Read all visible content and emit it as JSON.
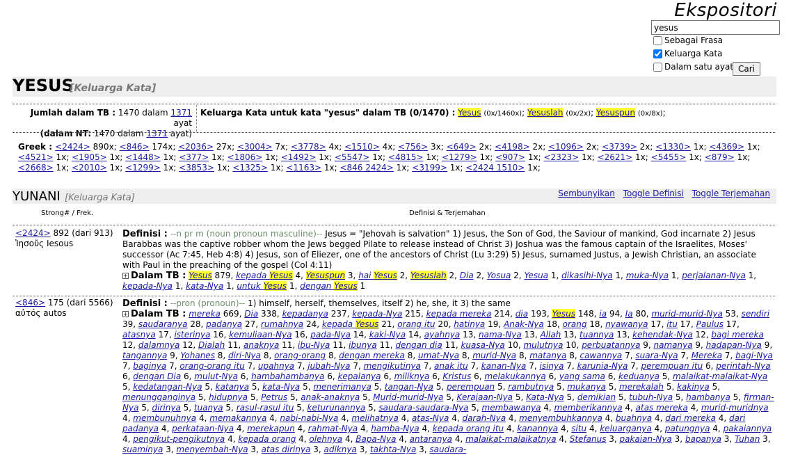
{
  "brand": "Ekspositori",
  "search": {
    "value": "yesus"
  },
  "options": [
    {
      "label": "Sebagai Frasa",
      "checked": false
    },
    {
      "label": "Keluarga Kata",
      "checked": true
    },
    {
      "label": "Dalam satu ayat",
      "checked": false
    }
  ],
  "cari_label": "Cari",
  "title": "YESUS",
  "title_tag": "[Keluarga Kata]",
  "stats": {
    "line1_prefix": "Jumlah dalam TB :",
    "line1_count": "1470",
    "line1_mid": "dalam",
    "line1_link": "1371",
    "line1_suffix": "ayat",
    "line2_prefix": "(dalam NT:",
    "line2_count": "1470",
    "line2_mid": "dalam",
    "line2_link": "1371",
    "line2_suffix": "ayat)"
  },
  "family": {
    "label": "Keluarga Kata untuk kata \"yesus\" dalam TB (0/1470) :",
    "items": [
      {
        "word": "Yesus",
        "count": "(0x/1460x)"
      },
      {
        "word": "Yesuslah",
        "count": "(0x/2x)"
      },
      {
        "word": "Yesuspun",
        "count": "(0x/8x)"
      }
    ]
  },
  "greek": {
    "label": "Greek :",
    "items": [
      [
        "<2424>",
        "890x"
      ],
      [
        "<846>",
        "174x"
      ],
      [
        "<2036>",
        "27x"
      ],
      [
        "<3004>",
        "7x"
      ],
      [
        "<3778>",
        "4x"
      ],
      [
        "<1510>",
        "4x"
      ],
      [
        "<756>",
        "3x"
      ],
      [
        "<649>",
        "2x"
      ],
      [
        "<4198>",
        "2x"
      ],
      [
        "<1096>",
        "2x"
      ],
      [
        "<3739>",
        "2x"
      ],
      [
        "<1330>",
        "1x"
      ],
      [
        "<4369>",
        "1x"
      ],
      [
        "<4521>",
        "1x"
      ],
      [
        "<1905>",
        "1x"
      ],
      [
        "<1448>",
        "1x"
      ],
      [
        "<377>",
        "1x"
      ],
      [
        "<1806>",
        "1x"
      ],
      [
        "<1492>",
        "1x"
      ],
      [
        "<5547>",
        "1x"
      ],
      [
        "<4815>",
        "1x"
      ],
      [
        "<1279>",
        "1x"
      ],
      [
        "<907>",
        "1x"
      ],
      [
        "<2323>",
        "1x"
      ],
      [
        "<2621>",
        "1x"
      ],
      [
        "<5455>",
        "1x"
      ],
      [
        "<879>",
        "1x"
      ],
      [
        "<2668>",
        "1x"
      ],
      [
        "<2010>",
        "1x"
      ],
      [
        "<1299>",
        "1x"
      ],
      [
        "<3853>",
        "1x"
      ],
      [
        "<1325>",
        "1x"
      ],
      [
        "<1163>",
        "1x"
      ],
      [
        "<846 2424>",
        "1x"
      ],
      [
        "<3199>",
        "1x"
      ],
      [
        "<2424 1510>",
        "1x"
      ]
    ]
  },
  "yunani": {
    "title": "YUNANI",
    "tag": "[Keluarga Kata]"
  },
  "section_links": [
    "Sembunyikan",
    "Toggle Definisi",
    "Toggle Terjemahan"
  ],
  "table_headers": {
    "left": "Strong# / Frek.",
    "right": "Definisi & Terjemahan"
  },
  "entries": [
    {
      "strong": "<2424>",
      "freq": "892 (dari 913)",
      "greek": "Ἰησοῦς",
      "translit": "Iesous",
      "def_label": "Definisi :",
      "pos": "--n pr m (noun pronoun masculine)--",
      "definition": "Jesus = \"Jehovah is salvation\" 1) Jesus, the Son of God, the Saviour of mankind, God incarnate 2) Jesus Barabbas was the captive robber whom the Jews begged Pilate to release instead of Christ 3) Joshua was the famous captain of the Israelites, Moses' successor (Ac 7:45, Heb 4:8) 4) Jesus, son of Eliezer, one of the ancestors of Christ (Lu 3:29) 5) Jesus, surnamed Justus, a Jewish Christian, an associate with Paul in the preaching of the gospel (Col 4:11)",
      "tb_label": "Dalam TB :",
      "words": [
        [
          "Yesus",
          "879"
        ],
        [
          "kepada Yesus",
          "4"
        ],
        [
          "Yesuspun",
          "3"
        ],
        [
          "hai Yesus",
          "2"
        ],
        [
          "Yesuslah",
          "2"
        ],
        [
          "Dia",
          "2"
        ],
        [
          "Yosua",
          "2"
        ],
        [
          "Yesua",
          "1"
        ],
        [
          "dikasihi-Nya",
          "1"
        ],
        [
          "muka-Nya",
          "1"
        ],
        [
          "perjalanan-Nya",
          "1"
        ],
        [
          "kepada-Nya",
          "1"
        ],
        [
          "kata-Nya",
          "1"
        ],
        [
          "untuk Yesus",
          "1"
        ],
        [
          "dengan Yesus",
          "1"
        ]
      ]
    },
    {
      "strong": "<846>",
      "freq": "175 (dari 5566)",
      "greek": "αὐτός",
      "translit": "autos",
      "def_label": "Definisi :",
      "pos": "--pron (pronoun)--",
      "definition": "1) himself, herself, themselves, itself 2) he, she, it 3) the same",
      "tb_label": "Dalam TB :",
      "words": [
        [
          "mereka",
          "669"
        ],
        [
          "Dia",
          "338"
        ],
        [
          "kepadanya",
          "237"
        ],
        [
          "kepada-Nya",
          "215"
        ],
        [
          "kepada mereka",
          "214"
        ],
        [
          "dia",
          "193"
        ],
        [
          "Yesus",
          "148"
        ],
        [
          "ia",
          "94"
        ],
        [
          "Ia",
          "80"
        ],
        [
          "murid-murid-Nya",
          "53"
        ],
        [
          "sendiri",
          "39"
        ],
        [
          "saudaranya",
          "28"
        ],
        [
          "padanya",
          "27"
        ],
        [
          "rumahnya",
          "24"
        ],
        [
          "kepada Yesus",
          "21"
        ],
        [
          "orang itu",
          "20"
        ],
        [
          "hatinya",
          "19"
        ],
        [
          "Anak-Nya",
          "18"
        ],
        [
          "orang",
          "18"
        ],
        [
          "nyawanya",
          "17"
        ],
        [
          "itu",
          "17"
        ],
        [
          "Paulus",
          "17"
        ],
        [
          "atasnya",
          "17"
        ],
        [
          "isterinya",
          "16"
        ],
        [
          "kemuliaan-Nya",
          "16"
        ],
        [
          "pada-Nya",
          "14"
        ],
        [
          "kaki-Nya",
          "14"
        ],
        [
          "ayahnya",
          "13"
        ],
        [
          "nama-Nya",
          "13"
        ],
        [
          "Allah",
          "13"
        ],
        [
          "tuannya",
          "13"
        ],
        [
          "kehendak-Nya",
          "12"
        ],
        [
          "bagi mereka",
          "12"
        ],
        [
          "dalamnya",
          "12"
        ],
        [
          "Dialah",
          "11"
        ],
        [
          "anaknya",
          "11"
        ],
        [
          "ibu-Nya",
          "11"
        ],
        [
          "ibunya",
          "11"
        ],
        [
          "dengan dia",
          "11"
        ],
        [
          "kuasa-Nya",
          "10"
        ],
        [
          "mulutnya",
          "10"
        ],
        [
          "perbuatannya",
          "9"
        ],
        [
          "namanya",
          "9"
        ],
        [
          "hadapan-Nya",
          "9"
        ],
        [
          "tangannya",
          "9"
        ],
        [
          "Yohanes",
          "8"
        ],
        [
          "diri-Nya",
          "8"
        ],
        [
          "orang-orang",
          "8"
        ],
        [
          "dengan mereka",
          "8"
        ],
        [
          "umat-Nya",
          "8"
        ],
        [
          "murid-Nya",
          "8"
        ],
        [
          "matanya",
          "8"
        ],
        [
          "cawannya",
          "7"
        ],
        [
          "suara-Nya",
          "7"
        ],
        [
          "Mereka",
          "7"
        ],
        [
          "bagi-Nya",
          "7"
        ],
        [
          "baginya",
          "7"
        ],
        [
          "orang-orang itu",
          "7"
        ],
        [
          "upahnya",
          "7"
        ],
        [
          "jubah-Nya",
          "7"
        ],
        [
          "mengikutinya",
          "7"
        ],
        [
          "anak itu",
          "7"
        ],
        [
          "kanan-Nya",
          "7"
        ],
        [
          "isinya",
          "7"
        ],
        [
          "karunia-Nya",
          "7"
        ],
        [
          "perempuan itu",
          "6"
        ],
        [
          "perintah-Nya",
          "6"
        ],
        [
          "dengan Dia",
          "6"
        ],
        [
          "mulut-Nya",
          "6"
        ],
        [
          "hambahambanya",
          "6"
        ],
        [
          "kepalanya",
          "6"
        ],
        [
          "miliknya",
          "6"
        ],
        [
          "Kristus",
          "6"
        ],
        [
          "melakukannya",
          "6"
        ],
        [
          "yang sama",
          "6"
        ],
        [
          "keduanya",
          "5"
        ],
        [
          "malaikat-malaikat-Nya",
          "5"
        ],
        [
          "kedatangan-Nya",
          "5"
        ],
        [
          "katanya",
          "5"
        ],
        [
          "kata-Nya",
          "5"
        ],
        [
          "menerimanya",
          "5"
        ],
        [
          "tangan-Nya",
          "5"
        ],
        [
          "perempuan",
          "5"
        ],
        [
          "rambutnya",
          "5"
        ],
        [
          "mukanya",
          "5"
        ],
        [
          "merekalah",
          "5"
        ],
        [
          "kakinya",
          "5"
        ],
        [
          "menungganginya",
          "5"
        ],
        [
          "hidupnya",
          "5"
        ],
        [
          "Petrus",
          "5"
        ],
        [
          "anak-anaknya",
          "5"
        ],
        [
          "Murid-murid-Nya",
          "5"
        ],
        [
          "Kerajaan-Nya",
          "5"
        ],
        [
          "Kata-Nya",
          "5"
        ],
        [
          "demikian",
          "5"
        ],
        [
          "tubuh-Nya",
          "5"
        ],
        [
          "hambanya",
          "5"
        ],
        [
          "firman-Nya",
          "5"
        ],
        [
          "dirinya",
          "5"
        ],
        [
          "tuanya",
          "5"
        ],
        [
          "rasul-rasul itu",
          "5"
        ],
        [
          "keturunannya",
          "5"
        ],
        [
          "saudara-saudara-Nya",
          "5"
        ],
        [
          "membawanya",
          "4"
        ],
        [
          "memberikannya",
          "4"
        ],
        [
          "atas mereka",
          "4"
        ],
        [
          "murid-muridnya",
          "4"
        ],
        [
          "membunuhnya",
          "4"
        ],
        [
          "memakannya",
          "4"
        ],
        [
          "nabi-nabi-Nya",
          "4"
        ],
        [
          "melihatnya",
          "4"
        ],
        [
          "atas-Nya",
          "4"
        ],
        [
          "darah-Nya",
          "4"
        ],
        [
          "menyembuhkannya",
          "4"
        ],
        [
          "buahnya",
          "4"
        ],
        [
          "dari mereka",
          "4"
        ],
        [
          "dari padanya",
          "4"
        ],
        [
          "perkataan-Nya",
          "4"
        ],
        [
          "merekapun",
          "4"
        ],
        [
          "rahmat-Nya",
          "4"
        ],
        [
          "hamba-Nya",
          "4"
        ],
        [
          "kepada orang itu",
          "4"
        ],
        [
          "kanannya",
          "4"
        ],
        [
          "situ",
          "4"
        ],
        [
          "keluarganya",
          "4"
        ],
        [
          "patungnya",
          "4"
        ],
        [
          "pakaiannya",
          "4"
        ],
        [
          "pengikut-pengikutnya",
          "4"
        ],
        [
          "kepada orang",
          "4"
        ],
        [
          "olehnya",
          "4"
        ],
        [
          "Bapa-Nya",
          "4"
        ],
        [
          "antaranya",
          "4"
        ],
        [
          "malaikat-malaikatnya",
          "4"
        ],
        [
          "Stefanus",
          "3"
        ],
        [
          "pakaian-Nya",
          "3"
        ],
        [
          "bapanya",
          "3"
        ],
        [
          "Tuhan",
          "3"
        ],
        [
          "suaminya",
          "3"
        ],
        [
          "menyembah-Nya",
          "3"
        ],
        [
          "atas dirinya",
          "3"
        ],
        [
          "adiknya",
          "3"
        ],
        [
          "takhta-Nya",
          "3"
        ],
        [
          "saudara-",
          ""
        ]
      ]
    }
  ]
}
